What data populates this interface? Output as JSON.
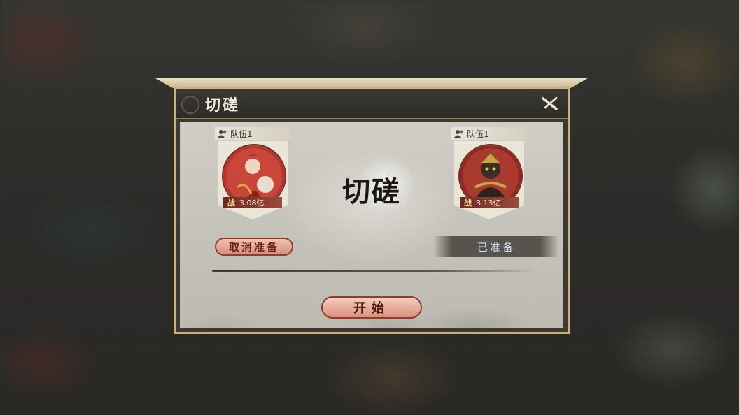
{
  "dialog": {
    "title": "切磋",
    "close_icon": "close-icon"
  },
  "teams": {
    "left": {
      "label": "队伍1",
      "power_prefix": "战",
      "power": "3.08亿"
    },
    "right": {
      "label": "队伍1",
      "power_prefix": "战",
      "power": "3.13亿"
    }
  },
  "center_text": "切磋",
  "buttons": {
    "cancel_ready": "取消准备",
    "ready_status": "已准备",
    "start": "开始"
  },
  "colors": {
    "frame": "#c9b37a",
    "button_fill": "#d88e7a",
    "button_text": "#6a1e14",
    "ready_text": "#cfe2ef"
  }
}
